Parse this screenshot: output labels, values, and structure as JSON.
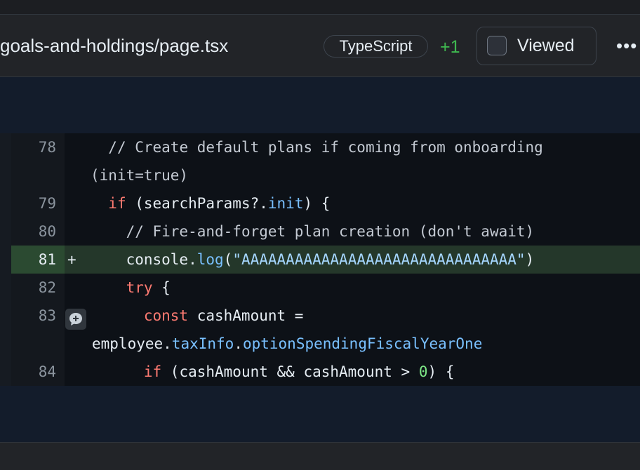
{
  "file": {
    "path": "goals-and-holdings/page.tsx",
    "language": "TypeScript",
    "added": "+1",
    "viewed_label": "Viewed"
  },
  "lines": {
    "l78": {
      "num": "78",
      "comment": "// Create default plans if coming from onboarding",
      "cont": "(init=true)"
    },
    "l79": {
      "num": "79",
      "kw": "if",
      "p1": " (searchParams?.",
      "prop": "init",
      "p2": ") {"
    },
    "l80": {
      "num": "80",
      "comment": "// Fire-and-forget plan creation (don't await)"
    },
    "l81": {
      "num": "81",
      "marker": "+",
      "obj": "console.",
      "fn": "log",
      "p1": "(",
      "str": "\"AAAAAAAAAAAAAAAAAAAAAAAAAAAAAAA\"",
      "p2": ")"
    },
    "l82": {
      "num": "82",
      "kw": "try",
      "p1": " {"
    },
    "l83": {
      "num": "83",
      "kw": "const",
      "p1": " cashAmount =",
      "c_obj": "employee.",
      "c_prop1": "taxInfo",
      "c_dot": ".",
      "c_prop2": "optionSpendingFiscalYearOne"
    },
    "l84": {
      "num": "84",
      "kw": "if",
      "p1": " (cashAmount && cashAmount > ",
      "n": "0",
      "p2": ") {"
    }
  },
  "icons": {
    "more": "ellipsis-icon",
    "comment": "add-comment-icon",
    "checkbox": "checkbox-icon"
  },
  "colors": {
    "added_line": "#24372a",
    "keyword": "#ff7b72",
    "function": "#79c0ff",
    "string": "#a5d6ff",
    "number": "#7ee787",
    "added_count": "#3fb950"
  }
}
